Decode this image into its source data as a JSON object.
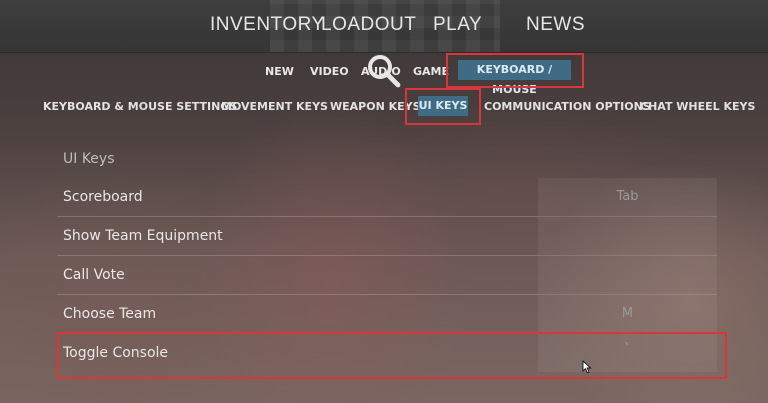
{
  "top_nav": {
    "items": [
      "INVENTORY",
      "LOADOUT",
      "PLAY",
      "NEWS"
    ]
  },
  "sub_nav": {
    "items": [
      "NEW",
      "VIDEO",
      "AUDIO",
      "GAME"
    ],
    "active": "KEYBOARD / MOUSE"
  },
  "tabs": {
    "items": [
      "KEYBOARD & MOUSE SETTINGS",
      "MOVEMENT KEYS",
      "WEAPON KEYS",
      "UI KEYS",
      "COMMUNICATION OPTIONS",
      "CHAT WHEEL KEYS"
    ]
  },
  "section": {
    "title": "UI Keys",
    "rows": [
      {
        "label": "Scoreboard",
        "key": "Tab"
      },
      {
        "label": "Show Team Equipment",
        "key": ""
      },
      {
        "label": "Call Vote",
        "key": ""
      },
      {
        "label": "Choose Team",
        "key": "M"
      },
      {
        "label": "Toggle Console",
        "key": "`"
      }
    ]
  },
  "colors": {
    "accent": "#3f6b85",
    "highlight_box": "#d8363a"
  }
}
